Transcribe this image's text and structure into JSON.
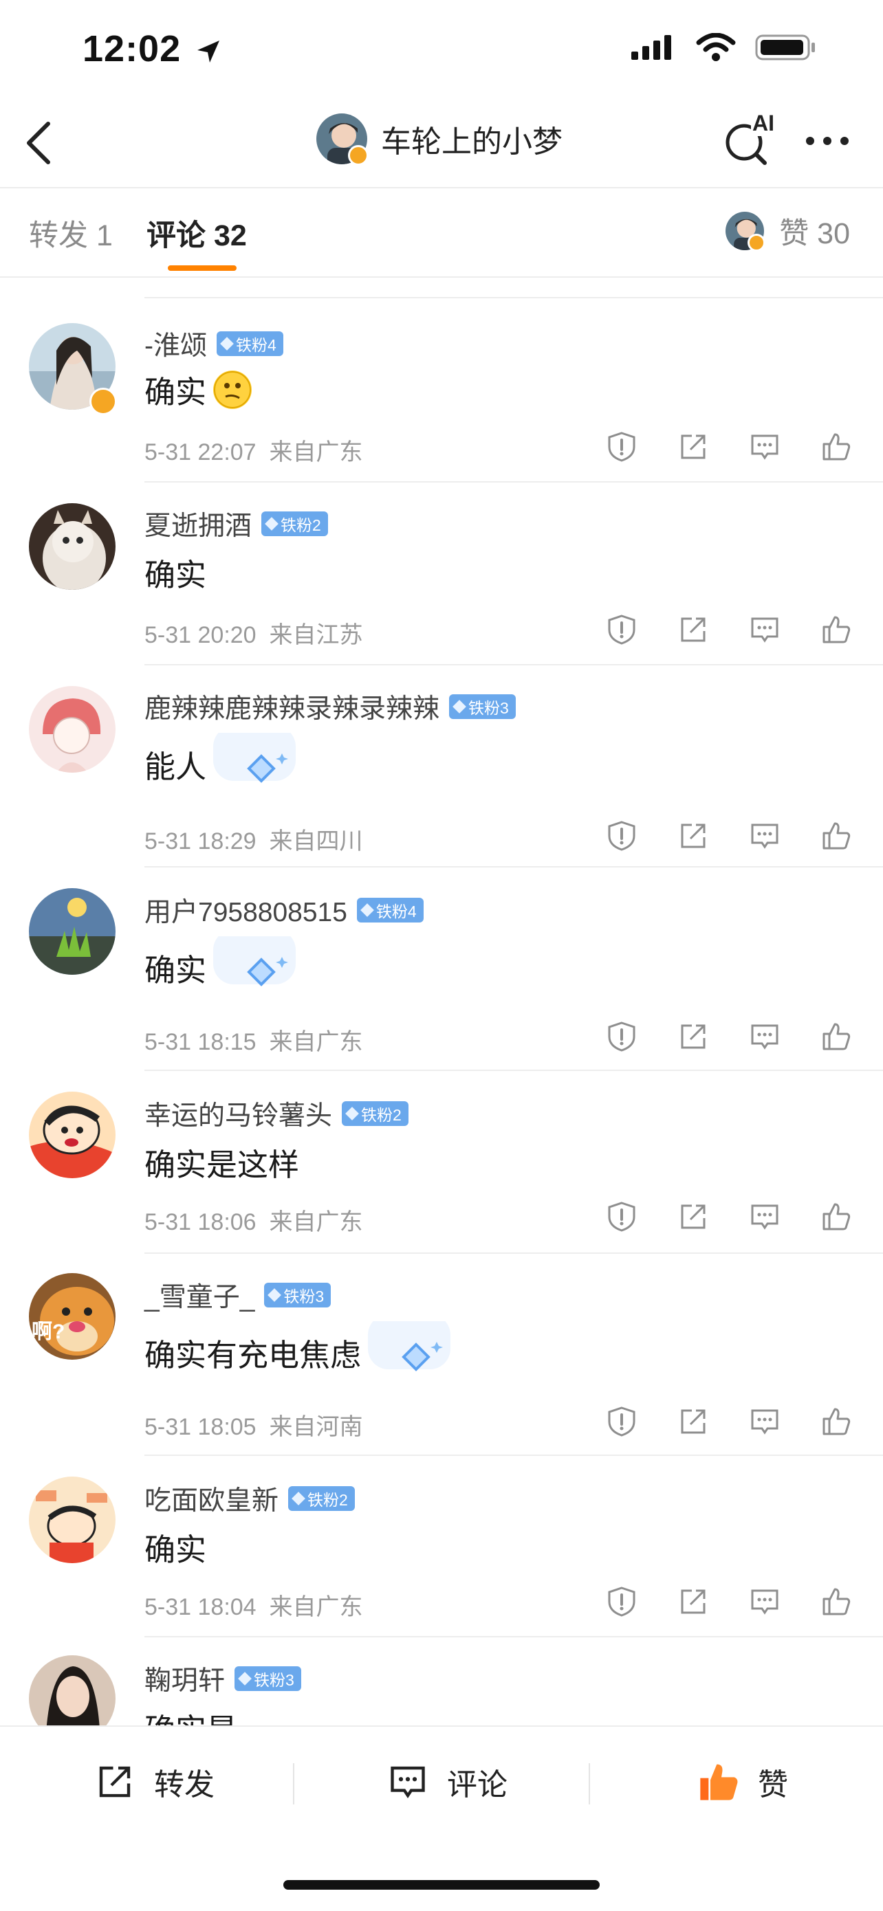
{
  "status_bar": {
    "time": "12:02"
  },
  "header": {
    "title": "车轮上的小梦",
    "ai_label": "AI"
  },
  "tabs": {
    "forward": "转发 1",
    "comment": "评论 32",
    "likes": "赞 30"
  },
  "comments": [
    {
      "user": "-淮颂",
      "fan_badge": "铁粉4",
      "text": "确实",
      "time": "5-31 22:07",
      "location": "来自广东"
    },
    {
      "user": "夏逝拥酒",
      "fan_badge": "铁粉2",
      "text": "确实",
      "time": "5-31 20:20",
      "location": "来自江苏"
    },
    {
      "user": "鹿辣辣鹿辣辣录辣录辣辣",
      "fan_badge": "铁粉3",
      "text": "能人",
      "time": "5-31 18:29",
      "location": "来自四川"
    },
    {
      "user": "用户7958808515",
      "fan_badge": "铁粉4",
      "text": "确实",
      "time": "5-31 18:15",
      "location": "来自广东"
    },
    {
      "user": "幸运的马铃薯头",
      "fan_badge": "铁粉2",
      "text": "确实是这样",
      "time": "5-31 18:06",
      "location": "来自广东"
    },
    {
      "user": "_雪童子_",
      "fan_badge": "铁粉3",
      "text": "确实有充电焦虑",
      "time": "5-31 18:05",
      "location": "来自河南"
    },
    {
      "user": "吃面欧皇新",
      "fan_badge": "铁粉2",
      "text": "确实",
      "time": "5-31 18:04",
      "location": "来自广东"
    },
    {
      "user": "鞠玥轩",
      "fan_badge": "铁粉3",
      "text": "确实是",
      "time": "",
      "location": ""
    }
  ],
  "avatar_text": {
    "c6": "啊?"
  },
  "bottom_bar": {
    "forward": "转发",
    "comment": "评论",
    "like": "赞"
  },
  "colors": {
    "accent": "#ff8200",
    "fan_badge": "#6aa8ec",
    "like_orange": "#ff6a1a"
  }
}
